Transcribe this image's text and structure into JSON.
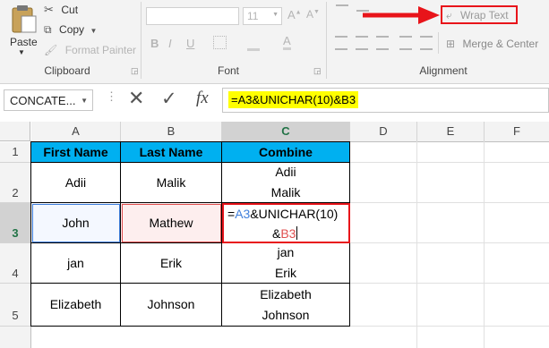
{
  "ribbon": {
    "clipboard": {
      "paste_label": "Paste",
      "cut_label": "Cut",
      "copy_label": "Copy",
      "format_painter_label": "Format Painter",
      "group_label": "Clipboard"
    },
    "font": {
      "font_size": "11",
      "bold": "B",
      "italic": "I",
      "underline": "U",
      "group_label": "Font"
    },
    "alignment": {
      "wrap_text_label": "Wrap Text",
      "merge_center_label": "Merge & Center",
      "group_label": "Alignment"
    }
  },
  "formula_bar": {
    "name_box": "CONCATE...",
    "fx": "fx",
    "formula": "=A3&UNICHAR(10)&B3"
  },
  "columns": [
    "A",
    "B",
    "C",
    "D",
    "E",
    "F"
  ],
  "rows": [
    "1",
    "2",
    "3",
    "4",
    "5"
  ],
  "table": {
    "headers": [
      "First Name",
      "Last Name",
      "Combine"
    ],
    "rows": [
      {
        "first": "Adii",
        "last": "Malik",
        "combine_line1": "Adii",
        "combine_line2": "Malik"
      },
      {
        "first": "John",
        "last": "Mathew",
        "combine_line1": "",
        "combine_line2": ""
      },
      {
        "first": "jan",
        "last": "Erik",
        "combine_line1": "jan",
        "combine_line2": "Erik"
      },
      {
        "first": "Elizabeth",
        "last": "Johnson",
        "combine_line1": "Elizabeth",
        "combine_line2": "Johnson"
      }
    ]
  },
  "edit_cell": {
    "eq": "=",
    "ref_a": "A3",
    "mid": "&UNICHAR(10)",
    "amp": "&",
    "ref_b": "B3"
  },
  "colors": {
    "header_fill": "#00b0f0",
    "highlight_red": "#e8141a",
    "formula_yellow": "#ffff00",
    "ref_a_blue": "#3f7fdc",
    "ref_b_red": "#e05050"
  }
}
